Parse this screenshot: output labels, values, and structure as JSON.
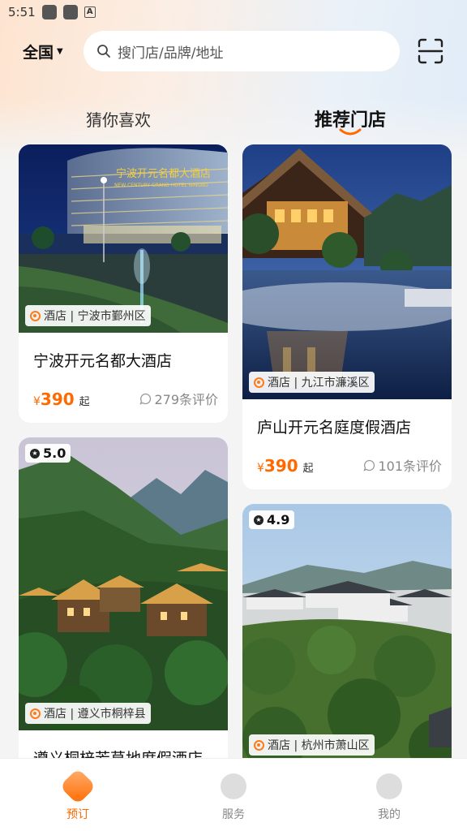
{
  "status_bar": {
    "time": "5:51",
    "input_indicator": "A"
  },
  "header": {
    "region": "全国",
    "search_placeholder": "搜门店/品牌/地址"
  },
  "tabs": [
    {
      "label": "猜你喜欢",
      "active": false
    },
    {
      "label": "推荐门店",
      "active": true
    }
  ],
  "colors": {
    "accent": "#ff6a00",
    "background": "#f4f4f4"
  },
  "cards": [
    {
      "tag": "酒店 | 宁波市鄞州区",
      "name": "宁波开元名都大酒店",
      "currency": "¥",
      "price": "390",
      "price_suffix": "起",
      "reviews": "279条评价",
      "image_sign": "宁波开元名都大酒店",
      "image_sign_en": "NEW CENTURY GRAND HOTEL NINGBO"
    },
    {
      "tag": "酒店 | 九江市濂溪区",
      "name": "庐山开元名庭度假酒店",
      "currency": "¥",
      "price": "390",
      "price_suffix": "起",
      "reviews": "101条评价"
    },
    {
      "rating": "5.0",
      "tag": "酒店 | 遵义市桐梓县",
      "name": "遵义桐梓芳草地度假酒店"
    },
    {
      "rating": "4.9",
      "tag": "酒店 | 杭州市萧山区"
    }
  ],
  "bottom_nav": [
    {
      "label": "预订",
      "icon": "booking-icon",
      "active": true
    },
    {
      "label": "服务",
      "icon": "service-icon",
      "active": false
    },
    {
      "label": "我的",
      "icon": "profile-icon",
      "active": false
    }
  ]
}
